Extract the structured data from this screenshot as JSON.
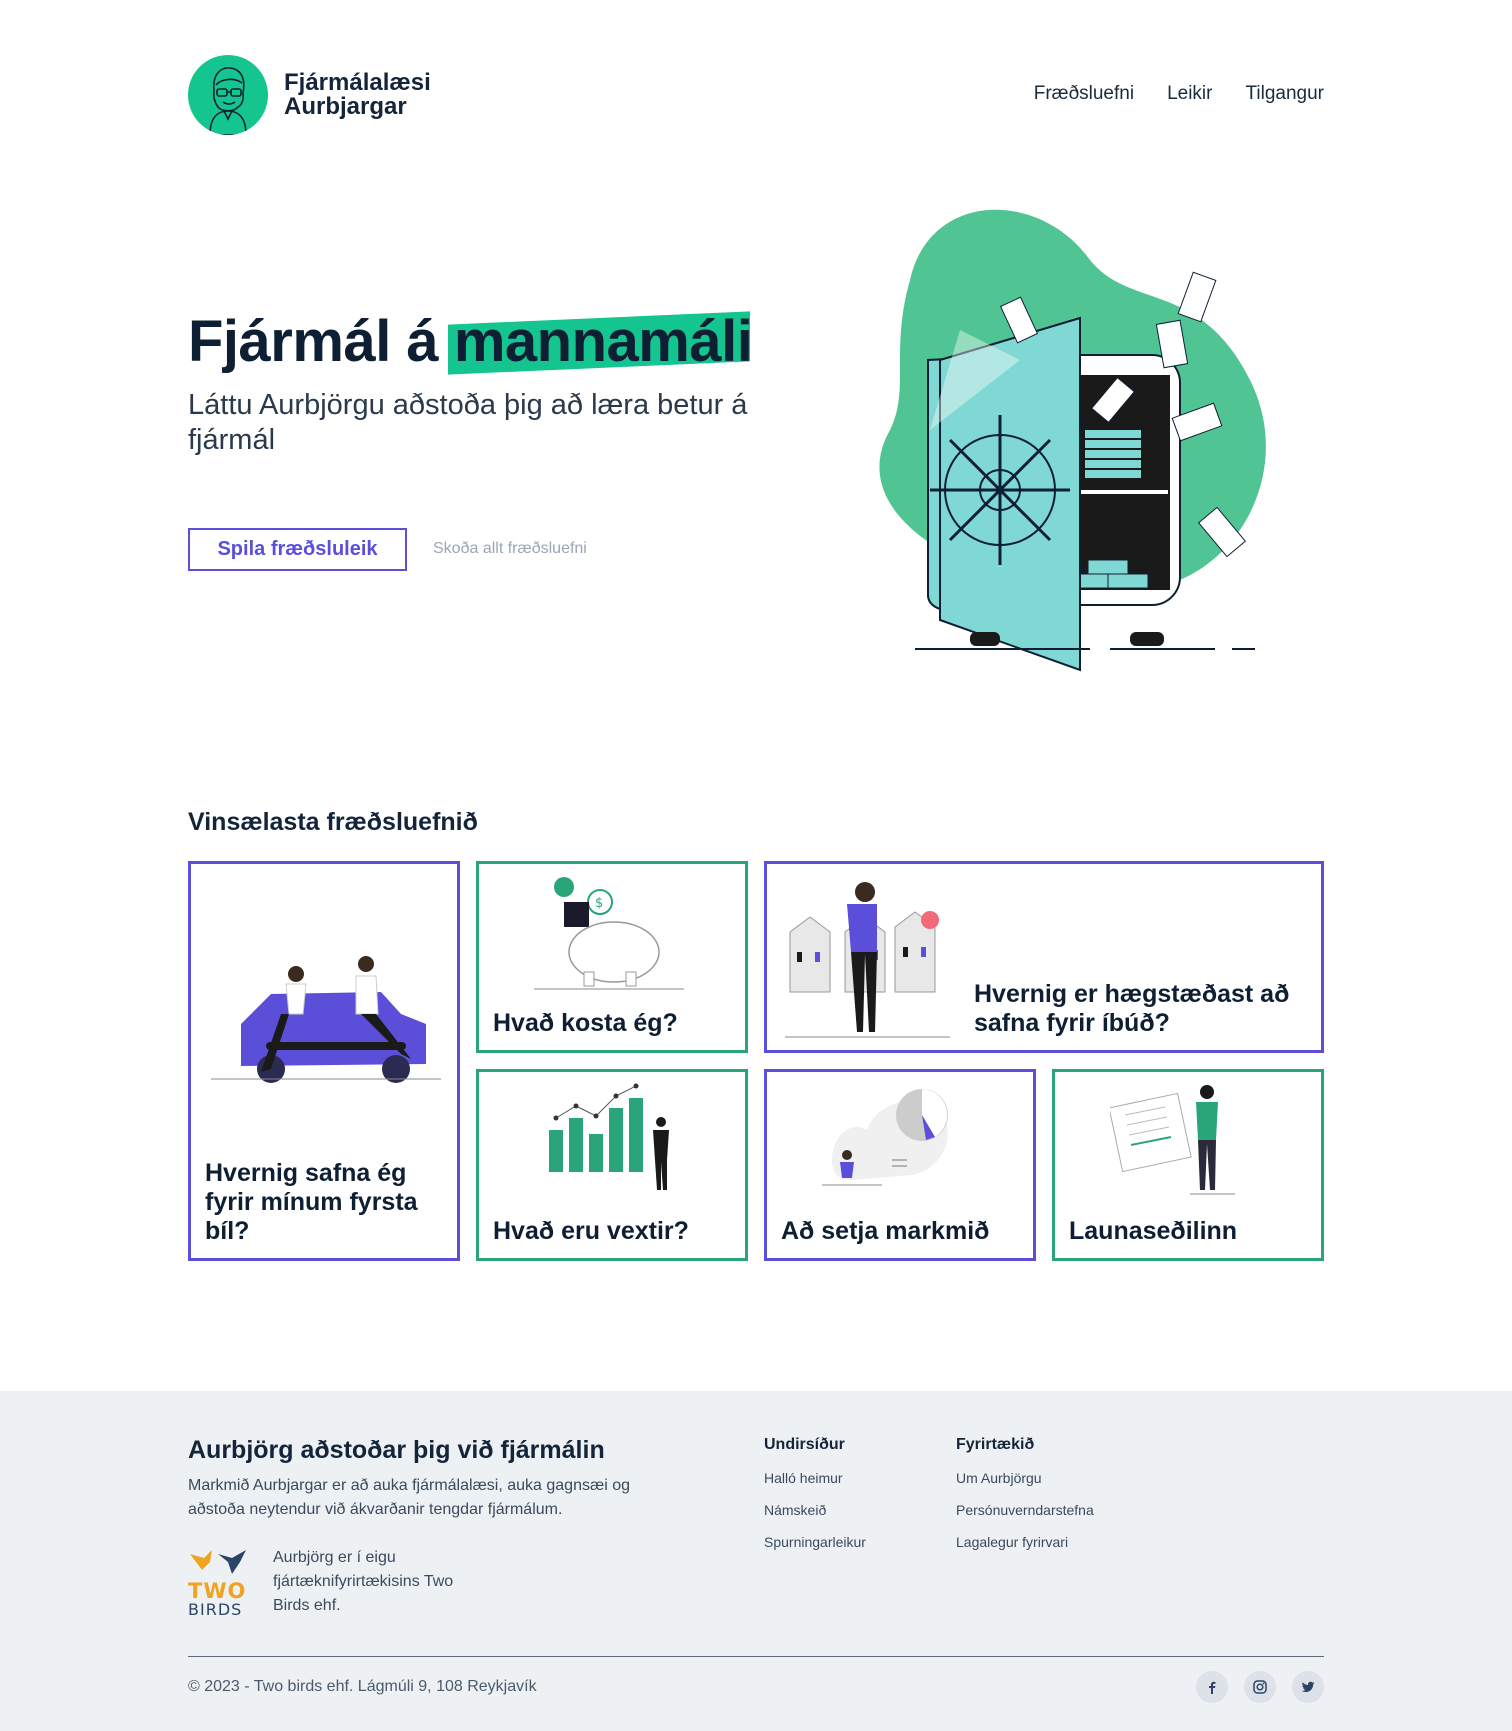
{
  "header": {
    "brand_line1": "Fjármálalæsi",
    "brand_line2": "Aurbjargar",
    "nav": [
      "Fræðsluefni",
      "Leikir",
      "Tilgangur"
    ]
  },
  "hero": {
    "title_plain": "Fjármál á",
    "title_highlight": "mannamáli",
    "subtitle": "Láttu Aurbjörgu aðstoða þig að læra betur á fjármál",
    "primary_button": "Spila fræðsluleik",
    "secondary_link": "Skoða allt fræðsluefni"
  },
  "popular": {
    "title": "Vinsælasta fræðsluefnið",
    "cards": [
      {
        "label": "Hvernig safna ég fyrir mínum fyrsta bíl?"
      },
      {
        "label": "Hvað kosta ég?"
      },
      {
        "label": "Hvernig er hægstæðast að safna fyrir íbúð?"
      },
      {
        "label": "Hvað eru vextir?"
      },
      {
        "label": "Að setja markmið"
      },
      {
        "label": "Launaseðilinn"
      }
    ]
  },
  "footer": {
    "title": "Aurbjörg aðstoðar þig við fjármálin",
    "description": "Markmið Aurbjargar er að auka fjármálalæsi, auka gagnsæi og aðstoða neytendur við ákvarðanir tengdar fjármálum.",
    "owner": "Aurbjörg er í eigu fjártæknifyrirtækisins Two Birds ehf.",
    "logo_text_top": "TWO",
    "logo_text_bottom": "BIRDS",
    "col1_title": "Undirsíður",
    "col1_links": [
      "Halló heimur",
      "Námskeið",
      "Spurningarleikur"
    ],
    "col2_title": "Fyrirtækið",
    "col2_links": [
      "Um Aurbjörgu",
      "Persónuverndarstefna",
      "Lagalegur fyrirvari"
    ],
    "copyright": "© 2023 - Two birds ehf. Lágmúli 9, 108 Reykjavík",
    "social": [
      "facebook-icon",
      "instagram-icon",
      "twitter-icon"
    ]
  },
  "colors": {
    "accent_green": "#15c58f",
    "accent_purple": "#5b4fd9",
    "card_green_border": "#2aa57a",
    "text_dark": "#0f1f33",
    "footer_bg": "#eef1f4"
  }
}
